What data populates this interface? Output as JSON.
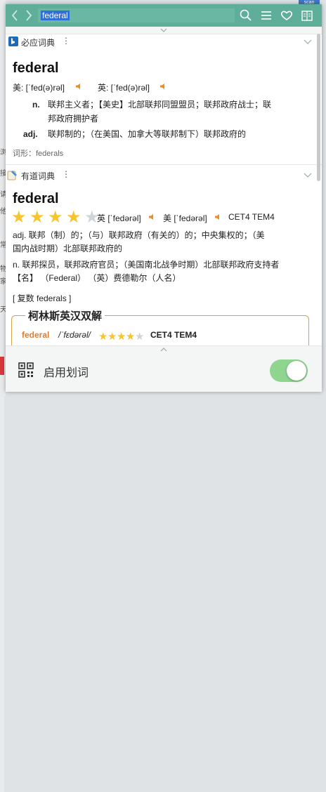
{
  "toolbar": {
    "search_value": "federal",
    "back_icon": "chevron-left-icon",
    "forward_icon": "chevron-right-icon",
    "search_icon": "search-icon",
    "menu_icon": "menu-icon",
    "favorite_icon": "heart-icon",
    "reading_icon": "reading-icon"
  },
  "background": {
    "tag": "scan",
    "side_chars": [
      "浏",
      "接",
      "请",
      "他",
      "常",
      "物",
      "家",
      "天"
    ]
  },
  "bing": {
    "name": "必应词典",
    "menu": "⋮",
    "word": "federal",
    "phonetic_us": "美: [ˈfed(ə)rəl]",
    "phonetic_uk": "英: [ˈfed(ə)rəl]",
    "senses": [
      {
        "pos": "n.",
        "lines": [
          "联邦主义者；【美史】北部联邦同盟盟员；联邦政府战士；联",
          "邦政府拥护者"
        ]
      },
      {
        "pos": "adj.",
        "lines": [
          "联邦制的；（在美国、加拿大等联邦制下）联邦政府的"
        ]
      }
    ],
    "forms": "词形：federals"
  },
  "youdao": {
    "name": "有道词典",
    "menu": "⋮",
    "word": "federal",
    "rating": 4,
    "rating_max": 5,
    "phonetic_uk": "英 [ˈfedərəl]",
    "phonetic_us": "美 [ˈfedərəl]",
    "levels": "CET4 TEM4",
    "lines": [
      "adj. 联邦（制）的；（与）联邦政府（有关的）的；中央集权的；（美",
      "国内战时期）北部联邦政府的",
      "n. 联邦探员，联邦政府官员；（美国南北战争时期）北部联邦政府支持者",
      "【名】 （Federal） （英）费德勒尔（人名）"
    ],
    "plural": "[ 复数 federals ]",
    "collins": {
      "title": "柯林斯英汉双解",
      "word": "federal",
      "phonetic": "/ˈfɛdərəl/",
      "rating": 4,
      "levels": "CET4 TEM4"
    }
  },
  "footer": {
    "label": "启用划词",
    "toggle_on": true
  },
  "colors": {
    "topbar": "#5eae9a",
    "speaker": "#f08a24",
    "star": "#f6c42b",
    "star_empty": "#cfd4d8",
    "collins_word": "#e07b2a",
    "toggle": "#8fd48f"
  }
}
